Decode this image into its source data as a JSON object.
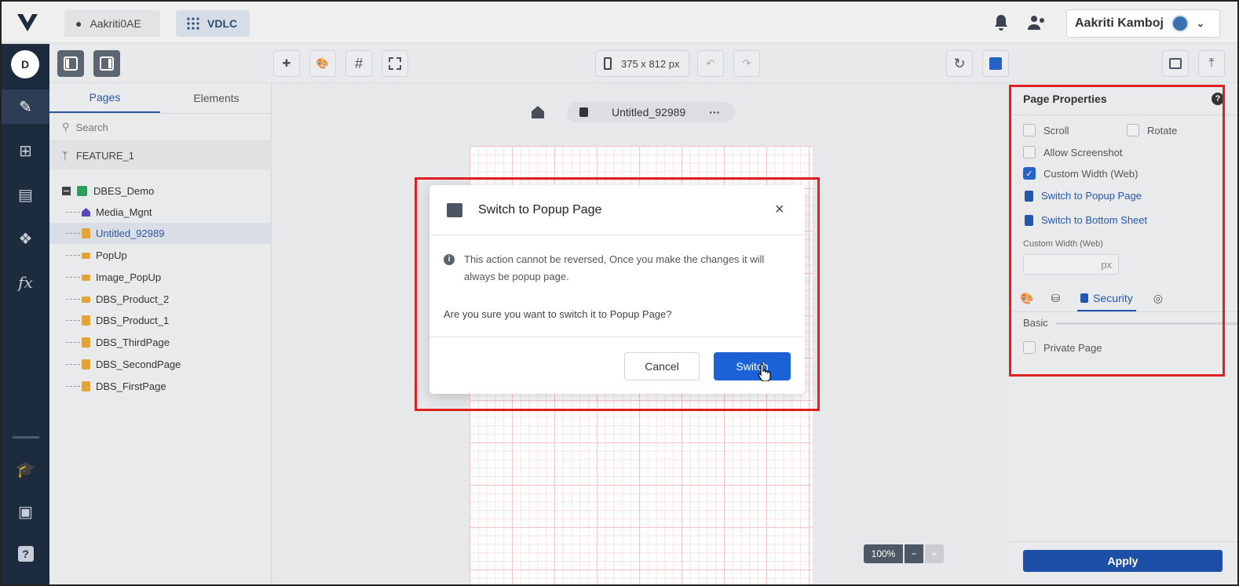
{
  "topbar": {
    "workspace": "Aakriti0AE",
    "project": "VDLC",
    "user_name": "Aakriti Kamboj"
  },
  "rail": {
    "avatar_letter": "D"
  },
  "toolbar": {
    "device_size": "375 x 812 px"
  },
  "pages_panel": {
    "tabs": [
      "Pages",
      "Elements"
    ],
    "search_placeholder": "Search",
    "branch": "FEATURE_1",
    "root": "DBES_Demo",
    "items": [
      "Media_Mgnt",
      "Untitled_92989",
      "PopUp",
      "Image_PopUp",
      "DBS_Product_2",
      "DBS_Product_1",
      "DBS_ThirdPage",
      "DBS_SecondPage",
      "DBS_FirstPage"
    ],
    "selected": "Untitled_92989"
  },
  "canvas": {
    "page_tab": "Untitled_92989",
    "zoom": "100%",
    "zoom_minus": "−",
    "zoom_plus": "+"
  },
  "properties": {
    "title": "Page Properties",
    "scroll": "Scroll",
    "rotate": "Rotate",
    "allow_screenshot": "Allow Screenshot",
    "custom_width_web": "Custom Width (Web)",
    "switch_popup": "Switch to Popup Page",
    "switch_bottom": "Switch to Bottom Sheet",
    "custom_width_label": "Custom Width (Web)",
    "px": "px",
    "security_tab": "Security",
    "basic": "Basic",
    "private_page": "Private Page",
    "apply": "Apply"
  },
  "dialog": {
    "title": "Switch to Popup Page",
    "close": "×",
    "info": "This action cannot be reversed, Once you make the changes it will always be popup page.",
    "question": "Are you sure you want to switch it to Popup Page?",
    "cancel": "Cancel",
    "switch": "Switch"
  },
  "colors": {
    "accent": "#1a62d6",
    "highlight_box": "#e02020",
    "rail_bg": "#1d2b3f"
  }
}
